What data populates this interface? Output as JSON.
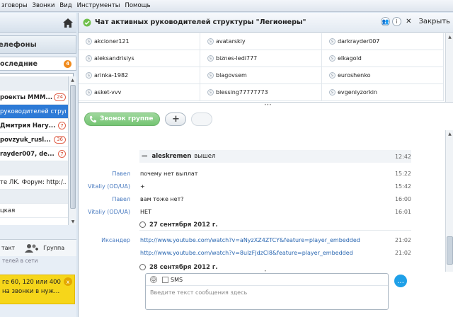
{
  "menu": [
    "зговоры",
    "Звонки",
    "Вид",
    "Инструменты",
    "Помощь"
  ],
  "left": {
    "phones_label": "елефоны",
    "recent_label": "оследние",
    "recent_badge": "4",
    "list": [
      {
        "text": "",
        "badge": "",
        "style": "gray"
      },
      {
        "text": "роекты МММ...",
        "badge": "24",
        "style": "bold"
      },
      {
        "text": "руководителей струк...",
        "badge": "",
        "style": "sel"
      },
      {
        "text": "Дмитрия Нагу...",
        "badge": "7",
        "style": "bold"
      },
      {
        "text": "povzyuk_rusl...",
        "badge": "36",
        "style": "bold"
      },
      {
        "text": "rayder007, de...",
        "badge": "7",
        "style": "bold"
      },
      {
        "text": "",
        "badge": "",
        "style": "gray"
      },
      {
        "text": "те ЛК. Форум: http:/...",
        "badge": "",
        "style": "plain"
      },
      {
        "text": "",
        "badge": "",
        "style": "gray"
      },
      {
        "text": "цкая",
        "badge": "",
        "style": "plain"
      }
    ],
    "contact_btn": "такт",
    "group_btn": "Группа",
    "online_label": "телей в сети",
    "promo_line1": "ге 60, 120 или 400",
    "promo_line2": "на звонки в нуж...",
    "promo_close": "x"
  },
  "chat": {
    "title": "Чат активных руководителей структуры \"Легионеры\"",
    "close_label": "Закрыть",
    "participants": [
      "akcioner121",
      "avatarskiy",
      "darkrayder007",
      "aleksandrisiys",
      "biznes-ledi777",
      "elkagold",
      "arinka-1982",
      "blagovsem",
      "euroshenko",
      "asket-vvv",
      "blessing77777773",
      "evgeniyzorkin"
    ],
    "call_button": "Звонок группе",
    "add_button": "+",
    "system_msg": {
      "user": "aleskremen",
      "action": "вышел",
      "time": "12:42"
    },
    "messages": [
      {
        "who": "Павел",
        "text": "почему нет выплат",
        "time": "15:22"
      },
      {
        "who": "Vitaliy (OD/UA)",
        "text": "+",
        "time": "15:42"
      },
      {
        "who": "Павел",
        "text": "вам тоже нет?",
        "time": "16:00"
      },
      {
        "who": "Vitaliy (OD/UA)",
        "text": "НЕТ",
        "time": "16:01"
      }
    ],
    "date1": "27 сентября 2012 г.",
    "messages2": [
      {
        "who": "Иксандер",
        "text": "http://www.youtube.com/watch?v=aNyzXZ4ZTCY&feature=player_embedded",
        "time": "21:02"
      },
      {
        "who": "",
        "text": "http://www.youtube.com/watch?v=8uIzFJdzCI8&feature=player_embedded",
        "time": "21:02"
      }
    ],
    "date2": "28 сентября 2012 г.",
    "sms_label": "SMS",
    "input_placeholder": "Введите текст сообщения здесь"
  }
}
